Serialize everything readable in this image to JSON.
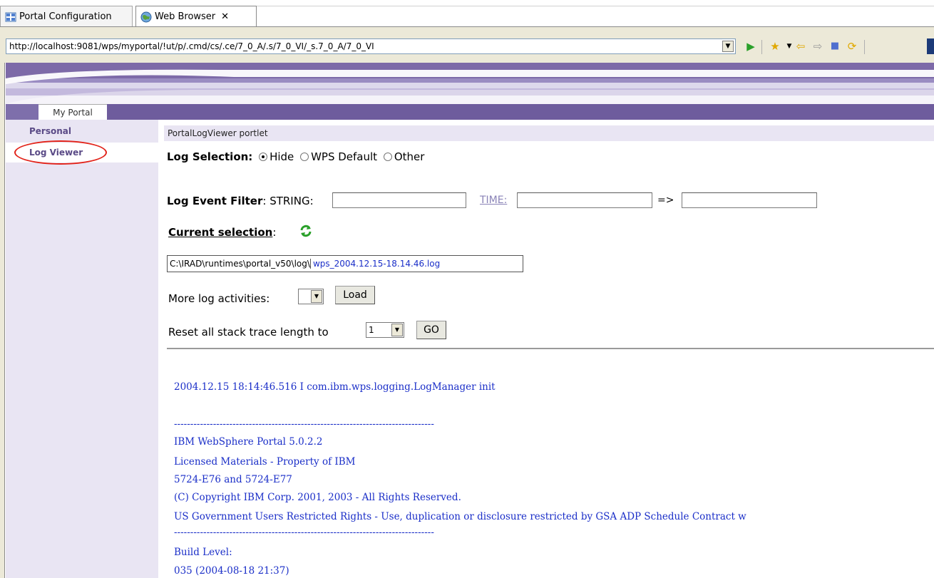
{
  "tabs": [
    {
      "label": "Portal Configuration",
      "icon": "grid-icon"
    },
    {
      "label": "Web Browser",
      "icon": "globe-icon",
      "close": "✕"
    }
  ],
  "address": {
    "url": "http://localhost:9081/wps/myportal/!ut/p/.cmd/cs/.ce/7_0_A/.s/7_0_VI/_s.7_0_A/7_0_VI"
  },
  "portal": {
    "nav_tab": "My Portal",
    "side": [
      {
        "label": "Personal"
      },
      {
        "label": "Log Viewer"
      }
    ],
    "portlet_title": "PortalLogViewer portlet"
  },
  "form": {
    "log_selection_label": "Log Selection:",
    "radio_hide": "Hide",
    "radio_default": "WPS Default",
    "radio_other": "Other",
    "filter_label": "Log Event Filter",
    "filter_string": ": STRING:",
    "time_link": "TIME:",
    "arrow": "=>",
    "current_selection": "Current selection",
    "colon": ":",
    "path_dir": "C:\\IRAD\\runtimes\\portal_v50\\log\\",
    "path_file": "wps_2004.12.15-18.14.46.log",
    "more_label": "More log activities:",
    "load_btn": "Load",
    "reset_label": "Reset all stack trace length to",
    "reset_value": "1",
    "go_btn": "GO"
  },
  "log": [
    "2004.12.15 18:14:46.516 I com.ibm.wps.logging.LogManager init",
    "--------------------------------------------------------------------------------",
    "IBM WebSphere Portal 5.0.2.2",
    "Licensed Materials - Property of IBM",
    "5724-E76 and 5724-E77",
    "(C) Copyright IBM Corp. 2001, 2003 - All Rights Reserved.",
    "US Government Users Restricted Rights - Use, duplication or disclosure restricted by GSA ADP Schedule Contract w",
    "--------------------------------------------------------------------------------",
    "Build Level:",
    "035 (2004-08-18 21:37)"
  ]
}
